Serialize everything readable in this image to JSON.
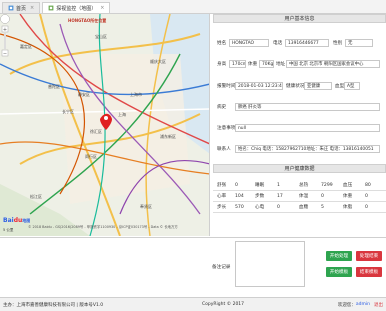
{
  "tabs": [
    {
      "label": "首页",
      "icon": "home-icon",
      "active": false
    },
    {
      "label": "探视监控（地图）",
      "icon": "monitor-icon",
      "active": true
    }
  ],
  "map": {
    "header_label": "HONGTAO所在位置",
    "labels": [
      "嘉定区",
      "宝山区",
      "顺庆大区",
      "上海市",
      "闵行区",
      "浦东新区",
      "松江区",
      "奉贤区",
      "上海",
      "徐汇区",
      "长宁区",
      "静安区",
      "普陀区"
    ],
    "logo_text": "Bai",
    "logo_suffix": "du",
    "logo_cn": "地图",
    "copyright": "© 2018 Baidu - GS(2016)2089号 - 甲测资字1100930 - 京ICP证030173号 - Data © 长地万方",
    "scale": "5 公里"
  },
  "user_info": {
    "title": "用户基本信息",
    "name_label": "姓名",
    "name_value": "HONGTAO",
    "phone_label": "电话",
    "phone_value": "13916446677",
    "gender_label": "性别",
    "gender_value": "无",
    "height_label": "身高",
    "height_value": "170cm",
    "weight_label": "体重",
    "weight_value": "70Kg",
    "address_label": "地址",
    "address_value": "中国 北京 北京市 朝阳区国家会议中心",
    "report_time_label": "报警时间",
    "report_time_value": "2018-01-03 12:23:43",
    "health_label": "健康状况",
    "health_value": "亚健康",
    "blood_label": "血型",
    "blood_value": "A型",
    "history_label": "病史",
    "history_value": "肺癌 肝炎等",
    "note_label": "注意事项",
    "note_value": "null",
    "contact_label": "联系人",
    "contact_value": "姓名：Chiq 电话：15827962710地址：朱庄 电话：13816140051"
  },
  "health_data": {
    "title": "用户健康数据",
    "rows": [
      [
        [
          "舒张",
          "0"
        ],
        [
          "睡眠",
          "1"
        ],
        [
          "总热",
          "7299"
        ],
        [
          "血压",
          "80"
        ]
      ],
      [
        [
          "心率",
          "104"
        ],
        [
          "步数",
          "17"
        ],
        [
          "体温",
          "0"
        ],
        [
          "体重",
          "0"
        ]
      ],
      [
        [
          "步长",
          "570"
        ],
        [
          "心电",
          "0"
        ],
        [
          "血糖",
          "5"
        ],
        [
          "体脂",
          "0"
        ]
      ]
    ]
  },
  "actions": {
    "notes_label": "备注记录",
    "start_process": "开始处理",
    "finish_process": "处理结束",
    "start_template": "开始模板",
    "end_template": "结束模板"
  },
  "footer": {
    "left": "主办：上海市嘉善健康科技有限公司 | 版本号V1.0",
    "center": "CopyRight © 2017",
    "right_prefix": "欢迎您：",
    "user": "admin",
    "logout": "退出"
  },
  "colors": {
    "accent_green": "#2ea44f",
    "accent_red": "#d9363e",
    "map_marker": "#e02020"
  }
}
